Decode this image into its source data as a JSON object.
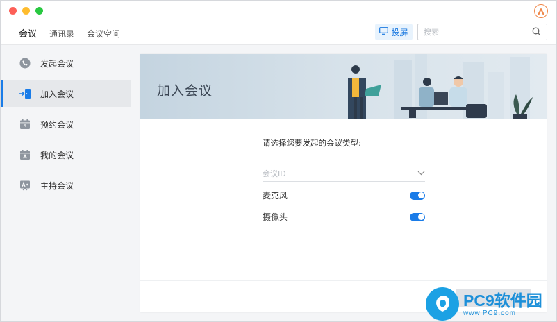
{
  "nav": {
    "items": [
      {
        "label": "会议",
        "active": true
      },
      {
        "label": "通讯录",
        "active": false
      },
      {
        "label": "会议空间",
        "active": false
      }
    ],
    "cast_label": "投屏",
    "search_placeholder": "搜索"
  },
  "sidebar": {
    "items": [
      {
        "label": "发起会议",
        "icon": "phone-icon",
        "active": false
      },
      {
        "label": "加入会议",
        "icon": "join-door-icon",
        "active": true
      },
      {
        "label": "预约会议",
        "icon": "calendar-clock-icon",
        "active": false
      },
      {
        "label": "我的会议",
        "icon": "calendar-user-icon",
        "active": false
      },
      {
        "label": "主持会议",
        "icon": "host-presenter-icon",
        "active": false
      }
    ]
  },
  "main": {
    "title": "加入会议",
    "prompt": "请选择您要发起的会议类型:",
    "meeting_id_placeholder": "会议ID",
    "toggles": [
      {
        "label": "麦克风",
        "on": true
      },
      {
        "label": "摄像头",
        "on": true
      }
    ]
  },
  "watermark": {
    "main": "PC9软件园",
    "sub": "www.PC9.com"
  },
  "colors": {
    "accent": "#1a7ce8",
    "watermark": "#1b8fd9"
  }
}
